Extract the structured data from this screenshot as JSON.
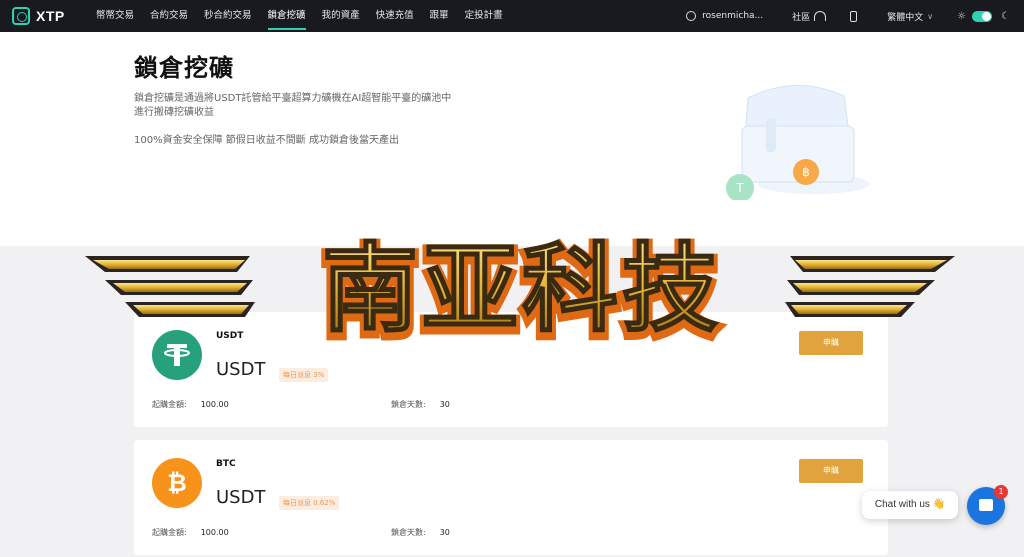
{
  "app": {
    "name": "XTP"
  },
  "nav": {
    "items": [
      {
        "label": "幣幣交易"
      },
      {
        "label": "合約交易"
      },
      {
        "label": "秒合約交易"
      },
      {
        "label": "鎖倉挖礦"
      },
      {
        "label": "我的資產"
      },
      {
        "label": "快速充值"
      },
      {
        "label": "跟單"
      },
      {
        "label": "定投計畫"
      }
    ],
    "active_index": 3,
    "user": "rosenmicha...",
    "community": "社區",
    "language": "繁體中文"
  },
  "banner": {
    "title": "鎖倉挖礦",
    "description": "鎖倉挖礦是通過將USDT託管給平臺超算力礦機在AI超智能平臺的礦池中進行搬磚挖礦收益",
    "sub": "100%資金安全保障 節假日收益不間斷 成功鎖倉後當天產出"
  },
  "watermark": {
    "text": "南亚科技"
  },
  "cards": [
    {
      "name": "USDT",
      "unit": "USDT",
      "rate_label": "每日派息 3%",
      "buy_label": "申購",
      "min_label": "起購金額:",
      "min_value": "100.00",
      "days_label": "鎖倉天數:",
      "days_value": "30",
      "coin_color": "#26a17b"
    },
    {
      "name": "BTC",
      "unit": "USDT",
      "rate_label": "每日派息 0.62%",
      "buy_label": "申購",
      "min_label": "起購金額:",
      "min_value": "100.00",
      "days_label": "鎖倉天數:",
      "days_value": "30",
      "coin_color": "#f7931a"
    }
  ],
  "chat": {
    "label": "Chat with us 👋",
    "badge": "1"
  },
  "colors": {
    "accent": "#2fd0b3",
    "buy_button": "#e0a33e",
    "chat": "#1b75e0"
  }
}
